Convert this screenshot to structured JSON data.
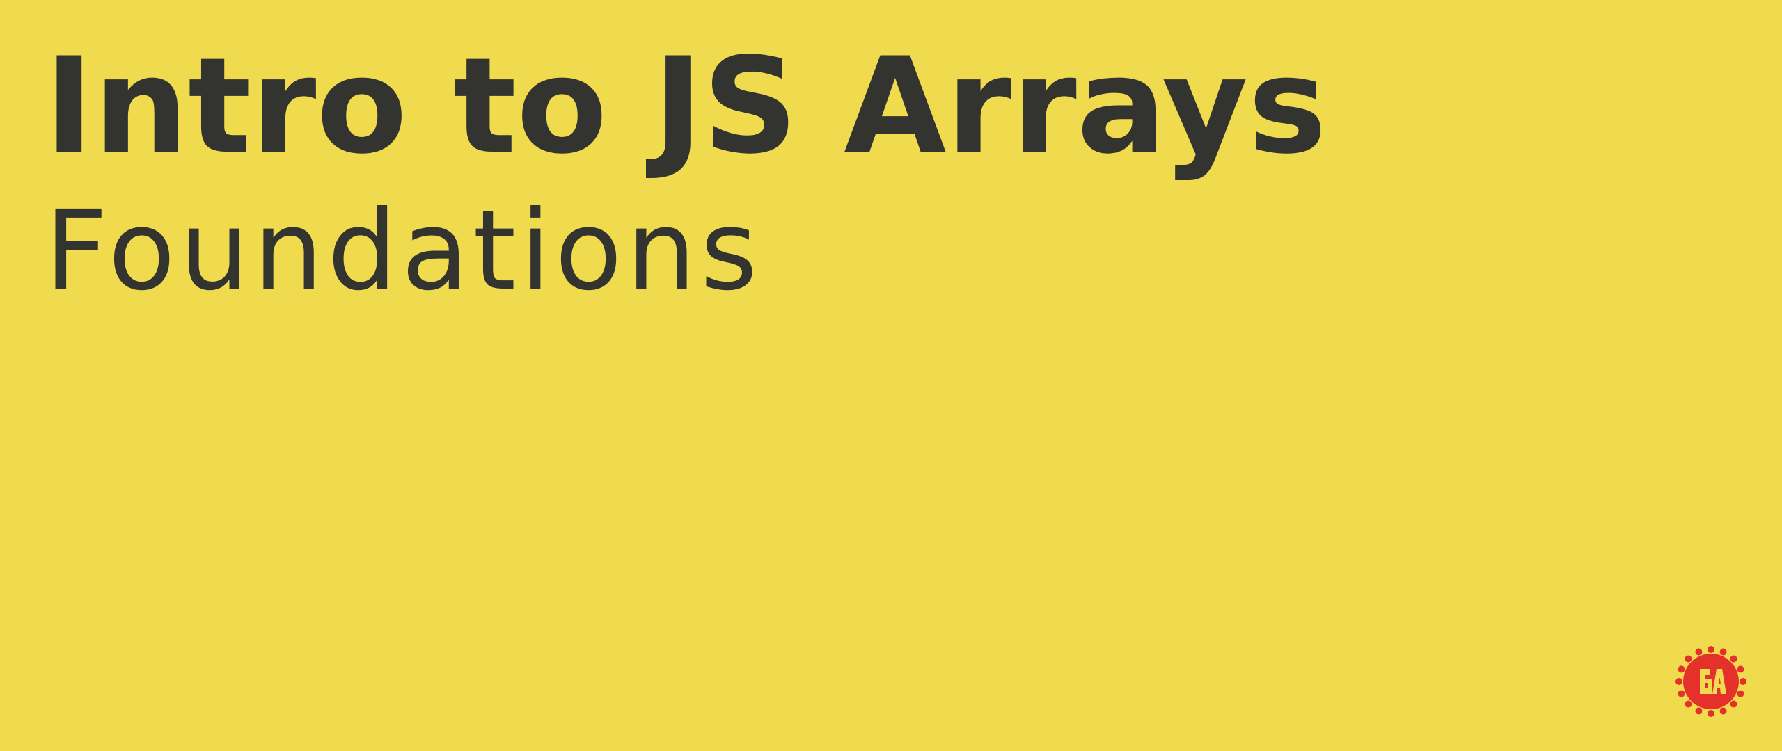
{
  "slide": {
    "title": "Intro to JS Arrays",
    "subtitle": "Foundations"
  },
  "logo": {
    "icon": "gear-logo-icon",
    "text": "GA",
    "color": "#E4312B"
  },
  "colors": {
    "background": "#F0DB4F",
    "text": "#333330",
    "logo_red": "#E4312B"
  }
}
